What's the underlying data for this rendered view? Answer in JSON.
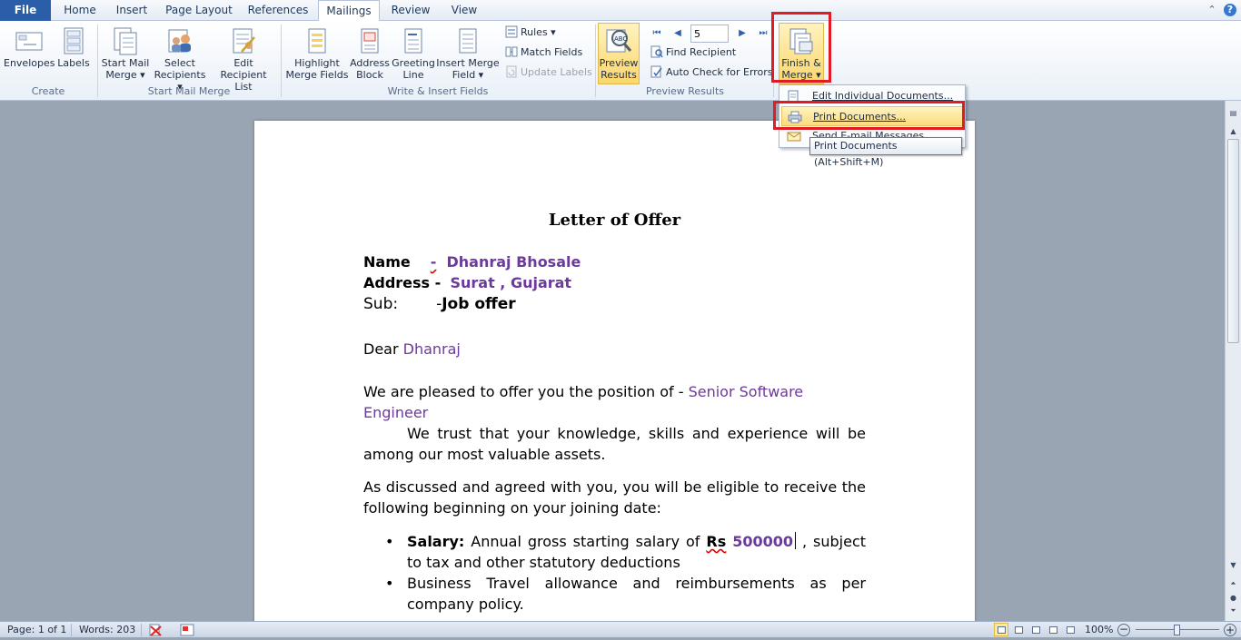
{
  "tabs": [
    "File",
    "Home",
    "Insert",
    "Page Layout",
    "References",
    "Mailings",
    "Review",
    "View"
  ],
  "active_tab": "Mailings",
  "ribbon": {
    "create": {
      "name": "Create",
      "envelopes": "Envelopes",
      "labels": "Labels"
    },
    "start_mail_merge": {
      "name": "Start Mail Merge",
      "start_line1": "Start Mail",
      "start_line2": "Merge ▾",
      "select_line1": "Select",
      "select_line2": "Recipients ▾",
      "edit_line1": "Edit",
      "edit_line2": "Recipient List"
    },
    "write_insert": {
      "name": "Write & Insert Fields",
      "highlight_line1": "Highlight",
      "highlight_line2": "Merge Fields",
      "address_line1": "Address",
      "address_line2": "Block",
      "greeting_line1": "Greeting",
      "greeting_line2": "Line",
      "insert_line1": "Insert Merge",
      "insert_line2": "Field ▾",
      "rules": "Rules ▾",
      "match_fields": "Match Fields",
      "update_labels": "Update Labels"
    },
    "preview": {
      "name": "Preview Results",
      "preview_line1": "Preview",
      "preview_line2": "Results",
      "record": "5",
      "find_recipient": "Find Recipient",
      "auto_check": "Auto Check for Errors"
    },
    "finish": {
      "finish_line1": "Finish &",
      "finish_line2": "Merge ▾"
    }
  },
  "menu": {
    "items": [
      "Edit Individual Documents...",
      "Print Documents...",
      "Send E-mail Messages..."
    ],
    "tooltip": "Print Documents (Alt+Shift+M)"
  },
  "document": {
    "title": "Letter of Offer",
    "name_label": "Name",
    "name_sep": "-",
    "name_value": "Dhanraj  Bhosale",
    "address_label": "Address -",
    "address_value": "Surat , Gujarat",
    "sub_label": "Sub:",
    "sub_sep": "-",
    "sub_value": "Job offer",
    "dear": "Dear",
    "dear_name": "Dhanraj",
    "position_text": "We are pleased to offer you the position of -",
    "position_value": "Senior Software Engineer",
    "para_trust": "We trust that your knowledge, skills and experience will be among our most valuable assets.",
    "para_discussed": "As discussed and agreed with you, you will be eligible to receive the following beginning on your joining date:",
    "salary_label": "Salary:",
    "salary_text": "Annual gross starting salary of",
    "salary_currency": "Rs",
    "salary_value": "500000",
    "salary_rest": ", subject to tax and other statutory deductions",
    "travel": "Business Travel allowance and reimbursements as per company policy."
  },
  "status": {
    "page": "Page: 1 of 1",
    "words": "Words: 203",
    "zoom": "100%"
  },
  "colors": {
    "accent": "#2a5ea8",
    "merge_field": "#6b3a9a",
    "highlight_box": "#e01b24",
    "menu_hover": "#fbdc7c"
  }
}
